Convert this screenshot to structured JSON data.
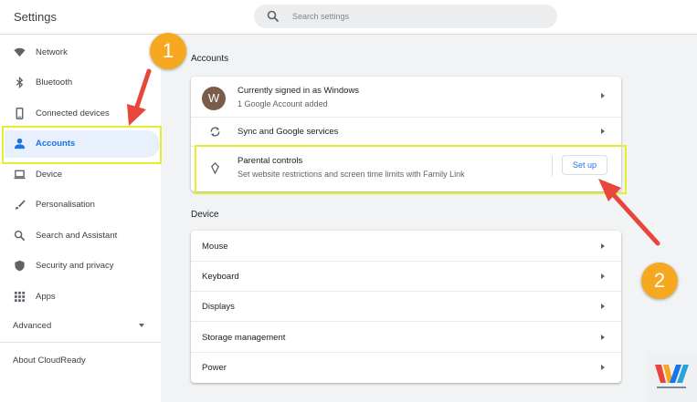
{
  "app": {
    "title": "Settings"
  },
  "search": {
    "placeholder": "Search settings"
  },
  "sidebar": {
    "items": [
      {
        "label": "Network",
        "icon": "wifi-icon"
      },
      {
        "label": "Bluetooth",
        "icon": "bluetooth-icon"
      },
      {
        "label": "Connected devices",
        "icon": "phone-icon"
      },
      {
        "label": "Accounts",
        "icon": "person-icon",
        "active": true
      },
      {
        "label": "Device",
        "icon": "laptop-icon"
      },
      {
        "label": "Personalisation",
        "icon": "brush-icon"
      },
      {
        "label": "Search and Assistant",
        "icon": "search-icon"
      },
      {
        "label": "Security and privacy",
        "icon": "shield-icon"
      },
      {
        "label": "Apps",
        "icon": "apps-grid-icon"
      }
    ],
    "advanced_label": "Advanced",
    "about_label": "About CloudReady"
  },
  "accounts": {
    "section_title": "Accounts",
    "signed_in": {
      "avatar_letter": "W",
      "title": "Currently signed in as Windows",
      "subtitle": "1 Google Account added"
    },
    "sync": {
      "title": "Sync and Google services"
    },
    "parental": {
      "title": "Parental controls",
      "subtitle": "Set website restrictions and screen time limits with Family Link",
      "button_label": "Set up"
    }
  },
  "device": {
    "section_title": "Device",
    "items": [
      "Mouse",
      "Keyboard",
      "Displays",
      "Storage management",
      "Power"
    ]
  },
  "annotations": {
    "step1": "1",
    "step2": "2"
  },
  "colors": {
    "accent": "#1a73e8",
    "active_bg": "#e8f0fe",
    "highlight": "#e6ee2a",
    "badge": "#f6a821",
    "arrow": "#e8453c",
    "avatar": "#7b5c4a"
  }
}
